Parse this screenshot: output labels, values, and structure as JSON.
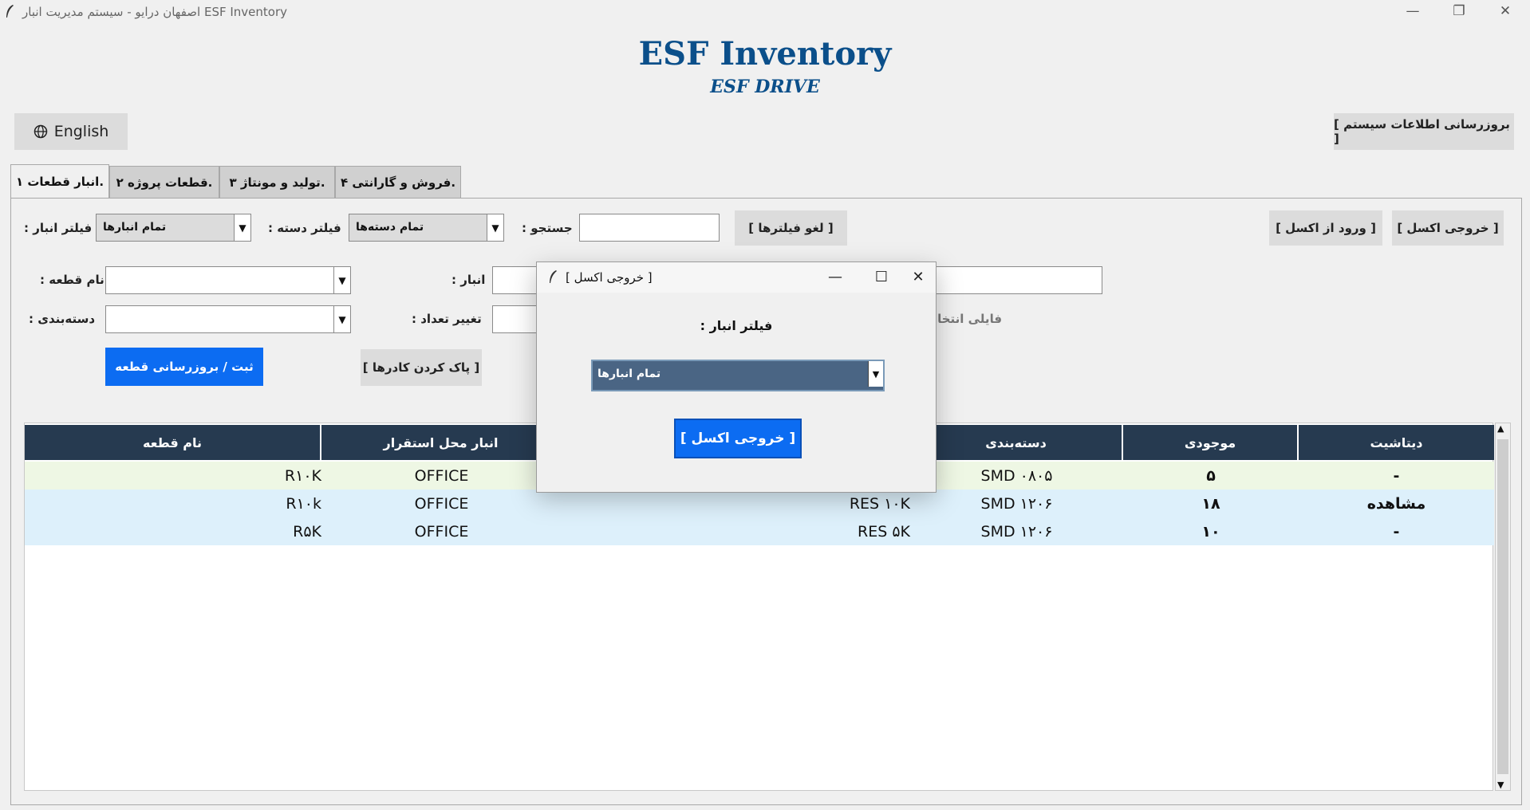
{
  "window": {
    "title": "اصفهان درایو - سیستم مدیریت انبار ESF Inventory",
    "minimize": "—",
    "restore": "❐",
    "close": "✕"
  },
  "header": {
    "title": "ESF Inventory",
    "subtitle": "ESF DRIVE"
  },
  "toolbar": {
    "language_button": "English",
    "language_icon": "globe-icon",
    "refresh_button": "[ بروزرسانی اطلاعات سیستم ]"
  },
  "tabs": [
    {
      "label": "انبار قطعات ۱.",
      "active": true
    },
    {
      "label": "قطعات پروژه ۲.",
      "active": false
    },
    {
      "label": "تولید و مونتاژ ۳.",
      "active": false
    },
    {
      "label": "فروش و گارانتی ۴.",
      "active": false
    }
  ],
  "filters": {
    "warehouse_label": ": فیلتر انبار",
    "warehouse_value": "تمام انبارها",
    "category_label": ": فیلتر دسته",
    "category_value": "تمام دسته‌ها",
    "search_label": ": جستجو",
    "search_value": "",
    "clear_filters_button": "[ لغو فیلترها ]",
    "import_excel_button": "[ ورود از اکسل ]",
    "export_excel_button": "[ خروجی اکسل ]"
  },
  "form": {
    "part_name_label": ": نام قطعه",
    "part_name_value": "",
    "category_label": ": دسته‌بندی",
    "category_value": "",
    "warehouse_label": ": انبار",
    "warehouse_value": "",
    "qty_change_label": ": تغییر تعداد",
    "qty_change_value": "",
    "file_hint": "فایلی انتخاب",
    "datasheet_value": "",
    "save_button": "ثبت / بروزرسانی قطعه",
    "clear_button": "[ پاک کردن کادرها ]"
  },
  "table": {
    "columns": [
      "نام قطعه",
      "انبار محل استقرار",
      "",
      "دسته‌بندی",
      "موجودی",
      "دیتاشیت"
    ],
    "rows": [
      {
        "name": "R۱۰K",
        "warehouse": "OFFICE",
        "desc": "",
        "category": "SMD ۰۸۰۵",
        "stock": "۵",
        "datasheet": "-",
        "color": "#eef7e4"
      },
      {
        "name": "R۱۰k",
        "warehouse": "OFFICE",
        "desc": "RES ۱۰K",
        "category": "SMD ۱۲۰۶",
        "stock": "۱۸",
        "datasheet": "مشاهده",
        "color": "#ddf0fb"
      },
      {
        "name": "R۵K",
        "warehouse": "OFFICE",
        "desc": "RES ۵K",
        "category": "SMD ۱۲۰۶",
        "stock": "۱۰",
        "datasheet": "-",
        "color": "#ddf0fb"
      }
    ]
  },
  "dialog": {
    "title": "[ خروجی اکسل ]",
    "label": ": فیلتر انبار",
    "combo_value": "تمام انبارها",
    "export_button": "[ خروجی اکسل ]",
    "minimize": "—",
    "maximize": "☐",
    "close": "✕"
  }
}
